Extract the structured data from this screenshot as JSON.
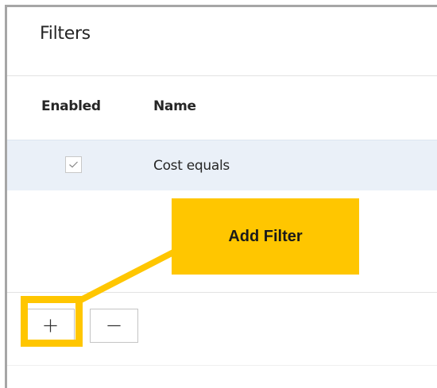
{
  "panel": {
    "title": "Filters"
  },
  "table": {
    "columns": [
      "Enabled",
      "Name"
    ],
    "rows": [
      {
        "enabled": true,
        "name": "Cost equals"
      }
    ]
  },
  "toolbar": {
    "add_icon": "plus-icon",
    "remove_icon": "minus-icon"
  },
  "callout": {
    "text": "Add Filter",
    "color": "#ffc600"
  },
  "colors": {
    "selected_row": "#eaf0f8",
    "panel_border": "#a6a6a6"
  }
}
